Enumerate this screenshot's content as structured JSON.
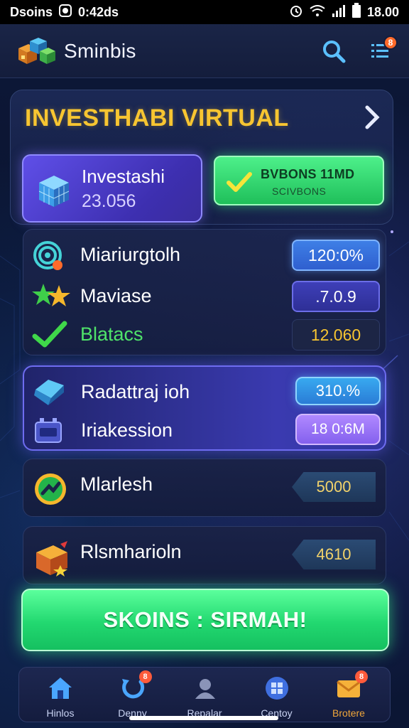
{
  "status_bar": {
    "left_text": "Dsoins",
    "carrier_extra": "0:42ds",
    "time": "18.00"
  },
  "header": {
    "app_name": "Sminbis",
    "icons": [
      "app-logo-icon",
      "search-icon",
      "menu-list-icon"
    ],
    "notification_badge": "8"
  },
  "main": {
    "title": "INVESTHABI VIRTUAL",
    "invest_card": {
      "label": "Investashi",
      "value": "23.056"
    },
    "green_card": {
      "line1": "BVBONS 11MD",
      "line2": "SCIVBONS"
    }
  },
  "stats": [
    {
      "label": "Miariurgtolh",
      "value": "120:0%",
      "pill": "blue",
      "icon": "wifi-signal-icon"
    },
    {
      "label": "Maviase",
      "value": ".7.0.9",
      "pill": "indigo",
      "icon": "stars-icon"
    },
    {
      "label": "Blatacs",
      "value": "12.060",
      "pill": "dark",
      "icon": "checkmark-icon"
    }
  ],
  "highlight": [
    {
      "label": "Radattraj ioh",
      "value": "310.%",
      "icon": "diamond-icon"
    },
    {
      "label": "Iriakession",
      "value": "18 0:6M",
      "icon": "battery-icon"
    }
  ],
  "rows": [
    {
      "label": "Mlarlesh",
      "value": "5000",
      "icon": "growth-badge-icon"
    },
    {
      "label": "Rlsmharioln",
      "value": "4610",
      "icon": "gift-box-icon"
    }
  ],
  "cta": {
    "label": "SKOINS : SIRMAH!"
  },
  "bottom_nav": [
    {
      "label": "Hinlos",
      "icon": "home-icon",
      "badge": ""
    },
    {
      "label": "Denny",
      "icon": "refresh-icon",
      "badge": "8"
    },
    {
      "label": "Repalar",
      "icon": "user-icon",
      "badge": ""
    },
    {
      "label": "Centoy",
      "icon": "grid-globe-icon",
      "badge": ""
    },
    {
      "label": "Brotere",
      "icon": "mail-icon",
      "badge": "8"
    }
  ],
  "colors": {
    "accent_gold": "#f7c531",
    "accent_green": "#22d870",
    "accent_purple": "#5f4fe8",
    "background": "#0b1330"
  }
}
